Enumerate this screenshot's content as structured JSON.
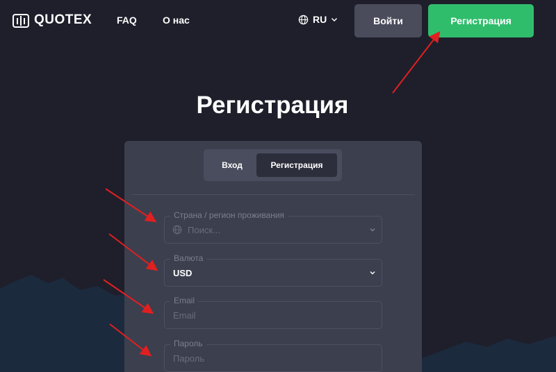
{
  "header": {
    "logo_text": "QUOTEX",
    "nav": {
      "faq": "FAQ",
      "about": "О нас"
    },
    "language": "RU",
    "login_label": "Войти",
    "register_label": "Регистрация"
  },
  "page": {
    "title": "Регистрация"
  },
  "form": {
    "tabs": {
      "login": "Вход",
      "register": "Регистрация"
    },
    "fields": {
      "country": {
        "label": "Страна / регион проживания",
        "placeholder": "Поиск..."
      },
      "currency": {
        "label": "Валюта",
        "value": "USD"
      },
      "email": {
        "label": "Email",
        "placeholder": "Email"
      },
      "password": {
        "label": "Пароль",
        "placeholder": "Пароль"
      }
    }
  },
  "colors": {
    "background": "#1e1f2b",
    "card": "#3c3f4e",
    "accent_green": "#2fbd6c",
    "annotation_red": "#e02020"
  },
  "icons": [
    "quotex-logo-icon",
    "globe-icon",
    "chevron-down-icon"
  ]
}
